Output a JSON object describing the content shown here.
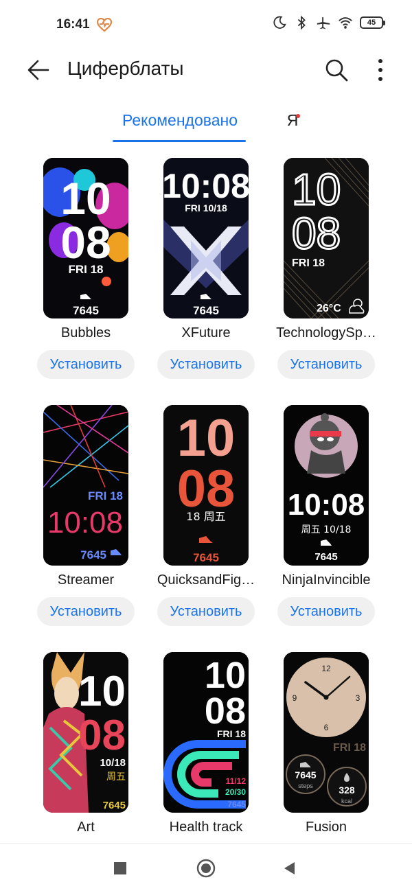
{
  "status": {
    "time": "16:41",
    "battery": "45"
  },
  "header": {
    "title": "Циферблаты"
  },
  "tabs": [
    {
      "label": "Рекомендовано"
    },
    {
      "label": "Я"
    }
  ],
  "install_label": "Установить",
  "faces": [
    {
      "name": "Bubbles",
      "hour": "10",
      "minute": "08",
      "date": "FRI 18",
      "steps": "7645"
    },
    {
      "name": "XFuture",
      "time": "10:08",
      "date": "FRI 10/18",
      "steps": "7645"
    },
    {
      "name": "TechnologySp…",
      "hour": "10",
      "minute": "08",
      "date": "FRI 18",
      "weather": "26°C"
    },
    {
      "name": "Streamer",
      "time": "10:08",
      "date": "FRI 18",
      "steps": "7645"
    },
    {
      "name": "QuicksandFig…",
      "hour": "10",
      "minute": "08",
      "date": "18 周五",
      "steps": "7645"
    },
    {
      "name": "NinjaInvincible",
      "time": "10:08",
      "date": "周五 10/18",
      "steps": "7645"
    },
    {
      "name": "Art",
      "hour": "10",
      "minute": "08",
      "date": "10/18",
      "weekday": "周五",
      "steps": "7645"
    },
    {
      "name": "Health track",
      "hour": "10",
      "minute": "08",
      "date": "FRI 18",
      "stat1": "11/12",
      "stat2": "20/30",
      "steps": "7645"
    },
    {
      "name": "Fusion",
      "n12": "12",
      "n3": "3",
      "n6": "6",
      "n9": "9",
      "date": "FRI 18",
      "steps": "7645",
      "steps_unit": "steps",
      "kcal": "328",
      "kcal_unit": "kcal"
    }
  ],
  "colors": {
    "accent": "#1a73e8",
    "tab_dot": "#e53935",
    "heart": "#e08a4a"
  },
  "icons": {
    "back": "arrow-left-icon",
    "search": "search-icon",
    "more": "more-vertical-icon",
    "nav_recent": "square-icon",
    "nav_home": "circle-icon",
    "nav_back": "triangle-back-icon"
  }
}
